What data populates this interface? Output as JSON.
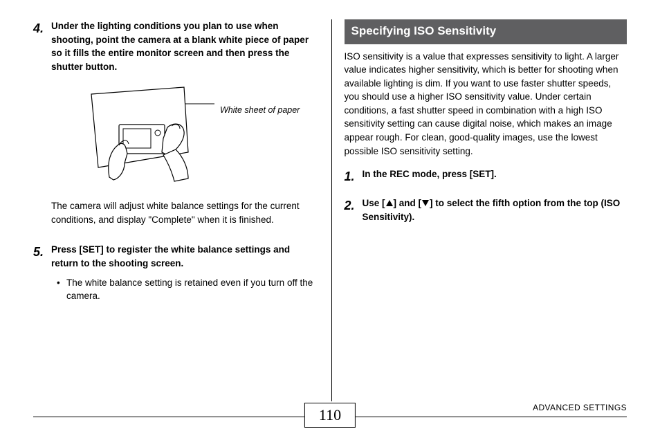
{
  "left": {
    "step4_num": "4.",
    "step4_head": "Under the lighting conditions you plan to use when shooting, point the camera at a blank white piece of paper so it fills the entire monitor screen and then press the shutter button.",
    "illus_label": "White sheet of paper",
    "step4_sub": "The camera will adjust white balance settings for the current conditions, and display \"Complete\" when it is finished.",
    "step5_num": "5.",
    "step5_head": "Press [SET] to register the white balance settings and return to the shooting screen.",
    "step5_bullet": "The white balance setting is retained even if you turn off the camera."
  },
  "right": {
    "section_title": "Specifying ISO Sensitivity",
    "para": "ISO sensitivity is a value that expresses sensitivity to light. A larger value indicates higher sensitivity, which is better for shooting when available lighting is dim. If you want to use faster shutter speeds, you should use a higher ISO sensitivity value. Under certain conditions, a fast shutter speed in combination with a high ISO sensitivity setting can cause digital noise, which makes an image appear rough. For clean, good-quality images, use the lowest possible ISO sensitivity setting.",
    "step1_num": "1.",
    "step1_head": "In the REC mode, press [SET].",
    "step2_num": "2.",
    "step2_pre": "Use [",
    "step2_mid": "] and [",
    "step2_post": "] to select the fifth option from the top (ISO Sensitivity)."
  },
  "footer": {
    "page": "110",
    "section": "ADVANCED SETTINGS"
  }
}
